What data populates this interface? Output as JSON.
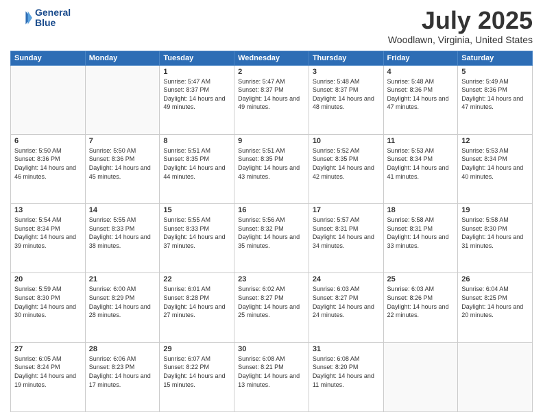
{
  "header": {
    "logo_line1": "General",
    "logo_line2": "Blue",
    "month_title": "July 2025",
    "location": "Woodlawn, Virginia, United States"
  },
  "weekdays": [
    "Sunday",
    "Monday",
    "Tuesday",
    "Wednesday",
    "Thursday",
    "Friday",
    "Saturday"
  ],
  "weeks": [
    [
      {
        "day": "",
        "empty": true
      },
      {
        "day": "",
        "empty": true
      },
      {
        "day": "1",
        "sunrise": "5:47 AM",
        "sunset": "8:37 PM",
        "daylight": "14 hours and 49 minutes."
      },
      {
        "day": "2",
        "sunrise": "5:47 AM",
        "sunset": "8:37 PM",
        "daylight": "14 hours and 49 minutes."
      },
      {
        "day": "3",
        "sunrise": "5:48 AM",
        "sunset": "8:37 PM",
        "daylight": "14 hours and 48 minutes."
      },
      {
        "day": "4",
        "sunrise": "5:48 AM",
        "sunset": "8:36 PM",
        "daylight": "14 hours and 47 minutes."
      },
      {
        "day": "5",
        "sunrise": "5:49 AM",
        "sunset": "8:36 PM",
        "daylight": "14 hours and 47 minutes."
      }
    ],
    [
      {
        "day": "6",
        "sunrise": "5:50 AM",
        "sunset": "8:36 PM",
        "daylight": "14 hours and 46 minutes."
      },
      {
        "day": "7",
        "sunrise": "5:50 AM",
        "sunset": "8:36 PM",
        "daylight": "14 hours and 45 minutes."
      },
      {
        "day": "8",
        "sunrise": "5:51 AM",
        "sunset": "8:35 PM",
        "daylight": "14 hours and 44 minutes."
      },
      {
        "day": "9",
        "sunrise": "5:51 AM",
        "sunset": "8:35 PM",
        "daylight": "14 hours and 43 minutes."
      },
      {
        "day": "10",
        "sunrise": "5:52 AM",
        "sunset": "8:35 PM",
        "daylight": "14 hours and 42 minutes."
      },
      {
        "day": "11",
        "sunrise": "5:53 AM",
        "sunset": "8:34 PM",
        "daylight": "14 hours and 41 minutes."
      },
      {
        "day": "12",
        "sunrise": "5:53 AM",
        "sunset": "8:34 PM",
        "daylight": "14 hours and 40 minutes."
      }
    ],
    [
      {
        "day": "13",
        "sunrise": "5:54 AM",
        "sunset": "8:34 PM",
        "daylight": "14 hours and 39 minutes."
      },
      {
        "day": "14",
        "sunrise": "5:55 AM",
        "sunset": "8:33 PM",
        "daylight": "14 hours and 38 minutes."
      },
      {
        "day": "15",
        "sunrise": "5:55 AM",
        "sunset": "8:33 PM",
        "daylight": "14 hours and 37 minutes."
      },
      {
        "day": "16",
        "sunrise": "5:56 AM",
        "sunset": "8:32 PM",
        "daylight": "14 hours and 35 minutes."
      },
      {
        "day": "17",
        "sunrise": "5:57 AM",
        "sunset": "8:31 PM",
        "daylight": "14 hours and 34 minutes."
      },
      {
        "day": "18",
        "sunrise": "5:58 AM",
        "sunset": "8:31 PM",
        "daylight": "14 hours and 33 minutes."
      },
      {
        "day": "19",
        "sunrise": "5:58 AM",
        "sunset": "8:30 PM",
        "daylight": "14 hours and 31 minutes."
      }
    ],
    [
      {
        "day": "20",
        "sunrise": "5:59 AM",
        "sunset": "8:30 PM",
        "daylight": "14 hours and 30 minutes."
      },
      {
        "day": "21",
        "sunrise": "6:00 AM",
        "sunset": "8:29 PM",
        "daylight": "14 hours and 28 minutes."
      },
      {
        "day": "22",
        "sunrise": "6:01 AM",
        "sunset": "8:28 PM",
        "daylight": "14 hours and 27 minutes."
      },
      {
        "day": "23",
        "sunrise": "6:02 AM",
        "sunset": "8:27 PM",
        "daylight": "14 hours and 25 minutes."
      },
      {
        "day": "24",
        "sunrise": "6:03 AM",
        "sunset": "8:27 PM",
        "daylight": "14 hours and 24 minutes."
      },
      {
        "day": "25",
        "sunrise": "6:03 AM",
        "sunset": "8:26 PM",
        "daylight": "14 hours and 22 minutes."
      },
      {
        "day": "26",
        "sunrise": "6:04 AM",
        "sunset": "8:25 PM",
        "daylight": "14 hours and 20 minutes."
      }
    ],
    [
      {
        "day": "27",
        "sunrise": "6:05 AM",
        "sunset": "8:24 PM",
        "daylight": "14 hours and 19 minutes."
      },
      {
        "day": "28",
        "sunrise": "6:06 AM",
        "sunset": "8:23 PM",
        "daylight": "14 hours and 17 minutes."
      },
      {
        "day": "29",
        "sunrise": "6:07 AM",
        "sunset": "8:22 PM",
        "daylight": "14 hours and 15 minutes."
      },
      {
        "day": "30",
        "sunrise": "6:08 AM",
        "sunset": "8:21 PM",
        "daylight": "14 hours and 13 minutes."
      },
      {
        "day": "31",
        "sunrise": "6:08 AM",
        "sunset": "8:20 PM",
        "daylight": "14 hours and 11 minutes."
      },
      {
        "day": "",
        "empty": true
      },
      {
        "day": "",
        "empty": true
      }
    ]
  ]
}
